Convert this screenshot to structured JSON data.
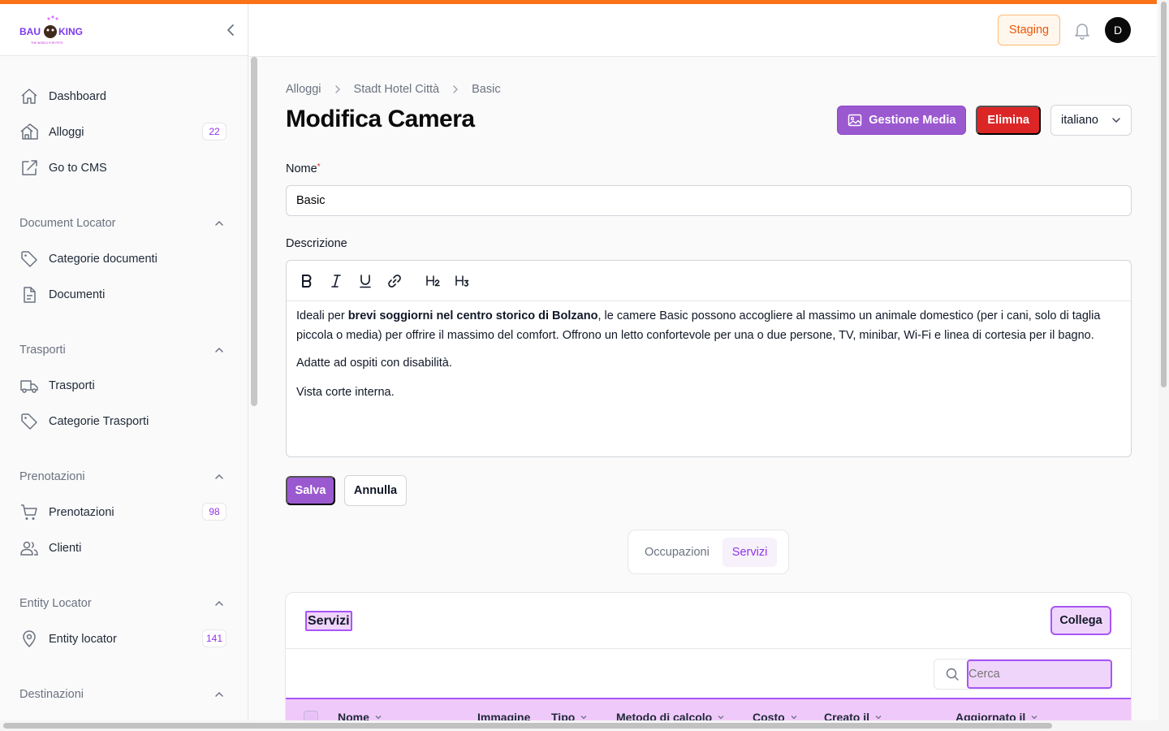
{
  "brand": {
    "logo_text": "BAU KING",
    "logo_tagline": "THE WORLD FOR PETS",
    "accent": "#f97316",
    "primary": "#9b59d0"
  },
  "header": {
    "environment_label": "Staging",
    "avatar_initial": "D"
  },
  "sidebar": {
    "top_items": [
      {
        "label": "Dashboard",
        "icon": "home-icon"
      },
      {
        "label": "Alloggi",
        "icon": "hotel-icon",
        "badge": "22"
      },
      {
        "label": "Go to CMS",
        "icon": "external-edit-icon"
      }
    ],
    "groups": [
      {
        "label": "Document Locator",
        "items": [
          {
            "label": "Categorie documenti",
            "icon": "tag-icon"
          },
          {
            "label": "Documenti",
            "icon": "document-icon"
          }
        ]
      },
      {
        "label": "Trasporti",
        "items": [
          {
            "label": "Trasporti",
            "icon": "truck-icon"
          },
          {
            "label": "Categorie Trasporti",
            "icon": "tag-icon"
          }
        ]
      },
      {
        "label": "Prenotazioni",
        "items": [
          {
            "label": "Prenotazioni",
            "icon": "cart-icon",
            "badge": "98"
          },
          {
            "label": "Clienti",
            "icon": "users-icon"
          }
        ]
      },
      {
        "label": "Entity Locator",
        "items": [
          {
            "label": "Entity locator",
            "icon": "map-pin-icon",
            "badge": "141"
          }
        ]
      },
      {
        "label": "Destinazioni",
        "items": []
      }
    ]
  },
  "breadcrumb": [
    "Alloggi",
    "Stadt Hotel Città",
    "Basic"
  ],
  "page": {
    "title": "Modifica Camera",
    "media_button": "Gestione Media",
    "delete_button": "Elimina",
    "language": "italiano"
  },
  "form": {
    "nome_label": "Nome",
    "nome_required": "*",
    "nome_value": "Basic",
    "descrizione_label": "Descrizione",
    "toolbar": {
      "h2": "H2",
      "h3": "H3"
    },
    "description": {
      "p1_before": "Ideali per ",
      "p1_bold": "brevi soggiorni nel centro storico di Bolzano",
      "p1_after": ", le camere Basic possono accogliere al massimo un animale domestico (per i cani, solo di taglia piccola o media) per offrire il massimo del comfort. Offrono un letto confortevole per una o due persone, TV, minibar, Wi-Fi e linea di cortesia per il bagno.",
      "p2": "Adatte ad ospiti con disabilità.",
      "p3": "Vista corte interna."
    },
    "save_button": "Salva",
    "cancel_button": "Annulla"
  },
  "tabs": [
    {
      "label": "Occupazioni",
      "active": false
    },
    {
      "label": "Servizi",
      "active": true
    }
  ],
  "services_card": {
    "title": "Servizi",
    "link_button": "Collega",
    "search_placeholder": "Cerca",
    "columns": [
      "Nome",
      "Immagine",
      "Tipo",
      "Metodo di calcolo",
      "Costo",
      "Creato il",
      "Aggiornato il"
    ]
  }
}
